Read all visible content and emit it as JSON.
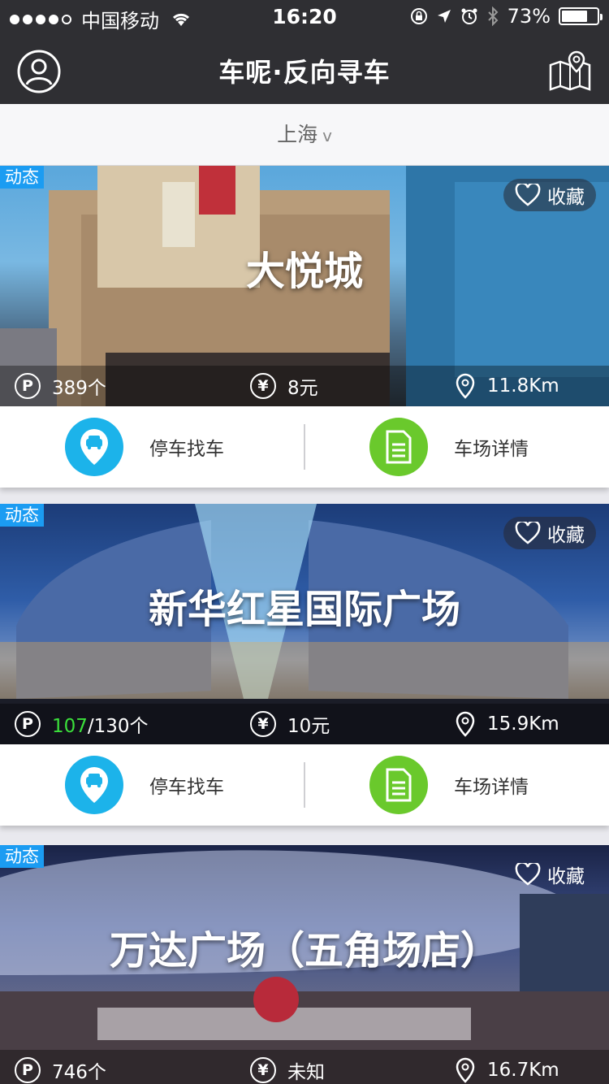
{
  "status_bar": {
    "carrier": "中国移动",
    "time": "16:20",
    "battery_percent": "73%",
    "battery_level": 0.73
  },
  "nav": {
    "title": "车呢·反向寻车",
    "left_icon": "user-icon",
    "right_icon": "map-pin-icon"
  },
  "city": {
    "name": "上海",
    "chevron": "v"
  },
  "cards": [
    {
      "tag": "动态",
      "favorite_label": "收藏",
      "name": "大悦城",
      "parking": "389个",
      "parking_available": "",
      "parking_total": "",
      "price": "8元",
      "distance": "11.8Km",
      "actions": {
        "find_car": "停车找车",
        "details": "车场详情"
      }
    },
    {
      "tag": "动态",
      "favorite_label": "收藏",
      "name": "新华红星国际广场",
      "parking": "",
      "parking_available": "107",
      "parking_total": "/130个",
      "price": "10元",
      "distance": "15.9Km",
      "actions": {
        "find_car": "停车找车",
        "details": "车场详情"
      }
    },
    {
      "tag": "动态",
      "favorite_label": "收藏",
      "name": "万达广场（五角场店）",
      "parking": "746个",
      "parking_available": "",
      "parking_total": "",
      "price": "未知",
      "distance": "16.7Km"
    }
  ],
  "icons": {
    "parking": "P",
    "yuan": "¥"
  },
  "colors": {
    "header_bg": "#2f2f33",
    "tag_blue": "#1b9cf2",
    "find_car_blue": "#1cb3ea",
    "details_green": "#6ac92c",
    "available_green": "#3be03b"
  }
}
